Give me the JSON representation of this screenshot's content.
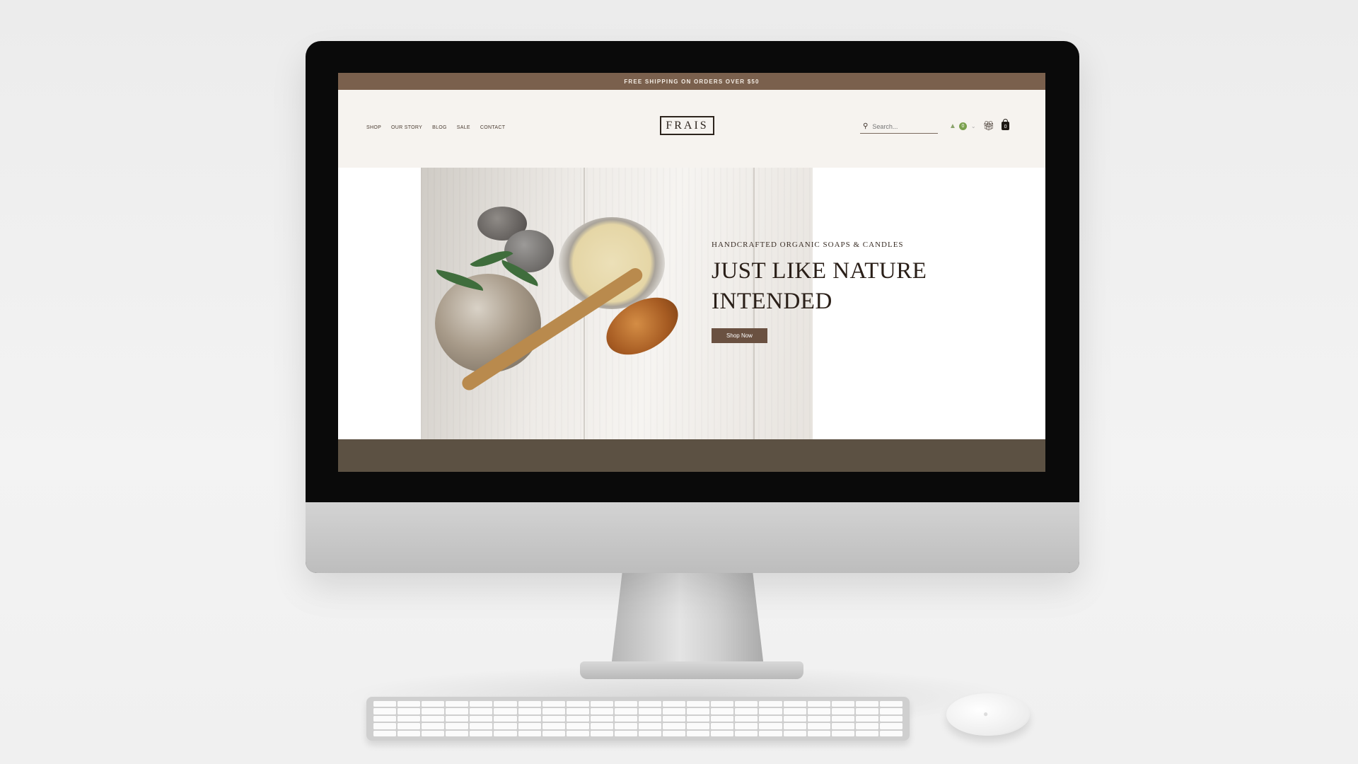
{
  "announcement": "FREE SHIPPING ON ORDERS OVER $50",
  "nav": {
    "items": [
      "SHOP",
      "OUR STORY",
      "BLOG",
      "SALE",
      "CONTACT"
    ]
  },
  "brand": {
    "logo_text": "FRAIS"
  },
  "search": {
    "placeholder": "Search..."
  },
  "header_icons": {
    "notification_count": "0",
    "cart_count": "0"
  },
  "hero": {
    "eyebrow": "HANDCRAFTED ORGANIC SOAPS & CANDLES",
    "title": "JUST LIKE NATURE INTENDED",
    "cta_label": "Shop Now"
  },
  "colors": {
    "announcement_bg": "#7a604d",
    "header_bg": "#f6f3ef",
    "cta_bg": "#6a5141",
    "footer_bg": "#5c5143",
    "badge_green": "#7aa04d"
  }
}
